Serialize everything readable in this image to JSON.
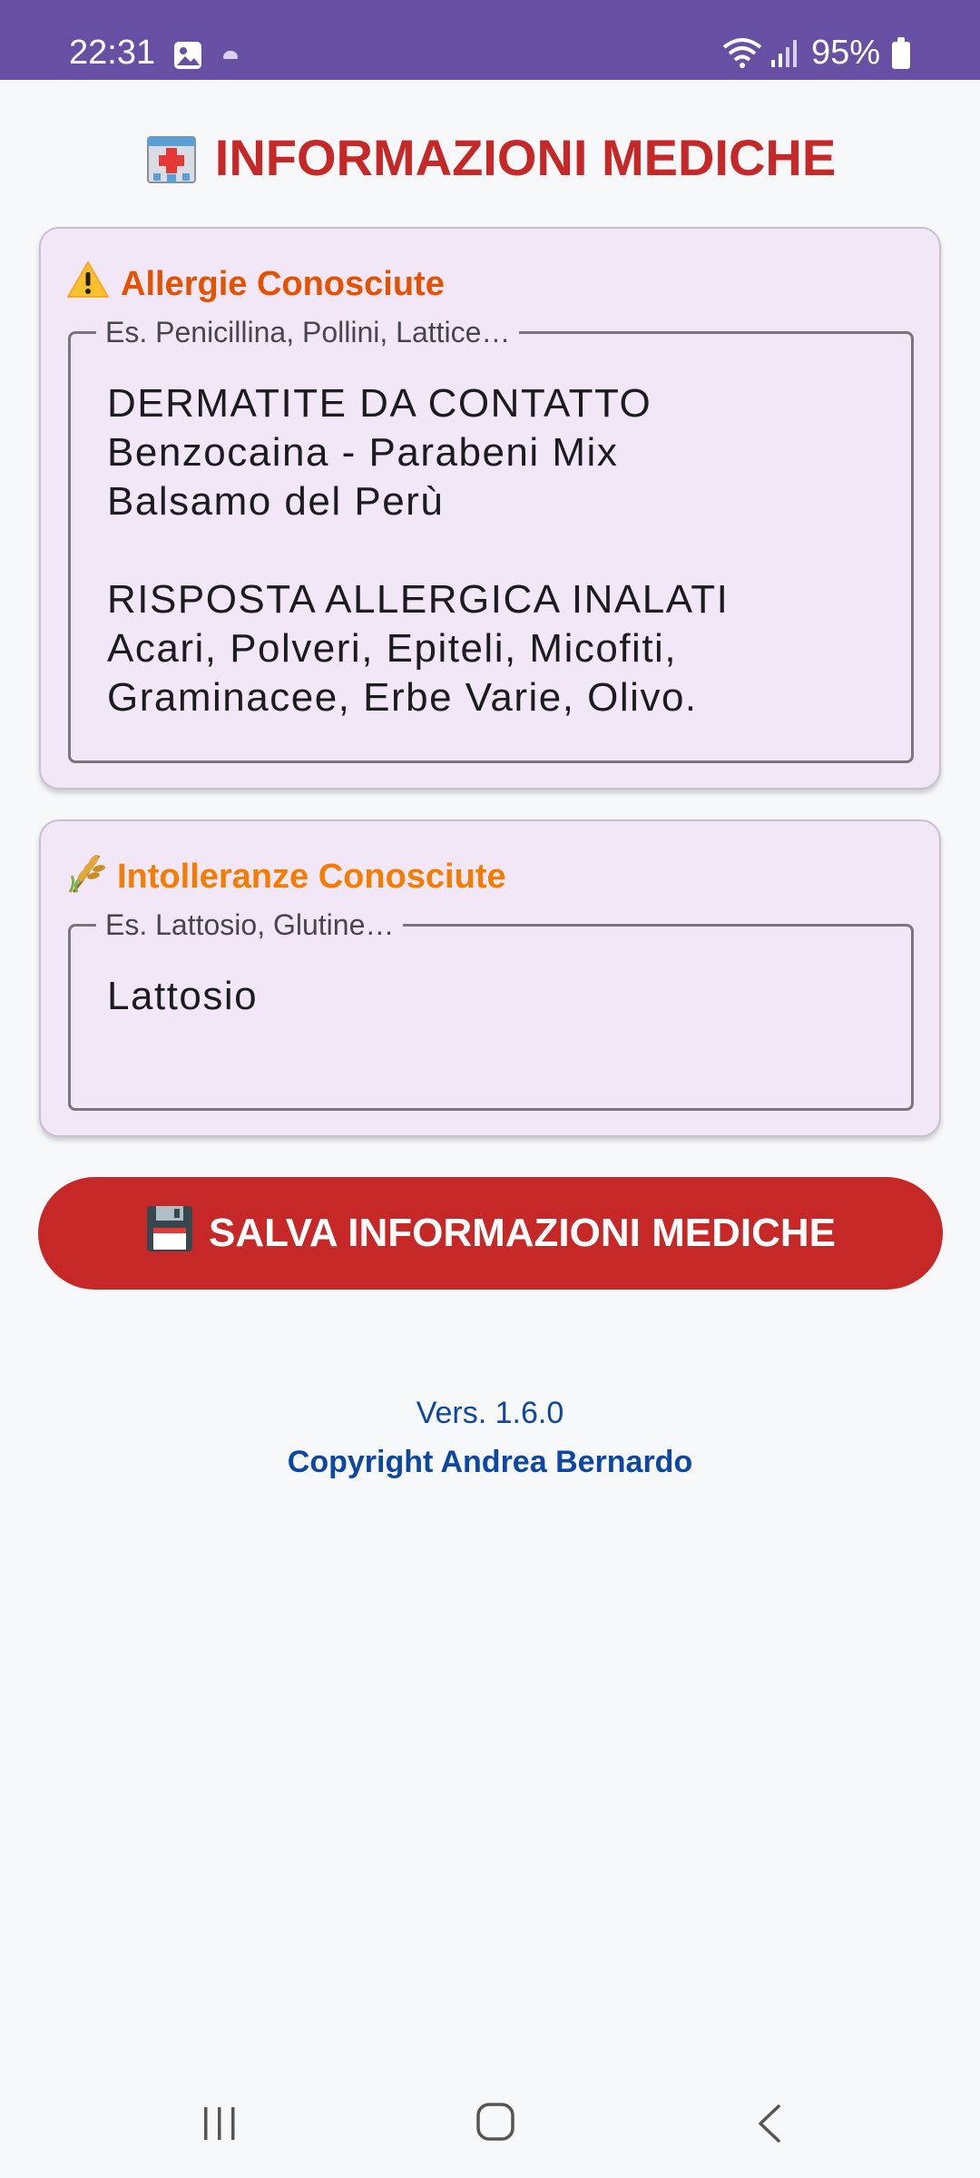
{
  "status_bar": {
    "time": "22:31",
    "battery": "95%",
    "icons": [
      "gallery-icon",
      "cloud-icon",
      "wifi-icon",
      "signal-icon",
      "battery-icon"
    ]
  },
  "header": {
    "title": "INFORMAZIONI MEDICHE",
    "icon": "hospital-icon",
    "color": "#c62828"
  },
  "allergies": {
    "heading": "Allergie Conosciute",
    "icon": "warning-icon",
    "label": "Es. Penicillina, Pollini, Lattice…",
    "value": "DERMATITE DA CONTATTO\nBenzocaina - Parabeni Mix\nBalsamo del Perù\n\nRISPOSTA ALLERGICA INALATI\nAcari, Polveri, Epiteli, Micofiti,\nGraminacee, Erbe Varie, Olivo."
  },
  "intolerances": {
    "heading": "Intolleranze Conosciute",
    "icon": "wheat-icon",
    "label": "Es. Lattosio, Glutine…",
    "value": "Lattosio"
  },
  "save_button": {
    "label": "SALVA INFORMAZIONI MEDICHE",
    "icon": "floppy-disk-icon"
  },
  "footer": {
    "version": "Vers. 1.6.0",
    "copyright": "Copyright Andrea Bernardo"
  },
  "colors": {
    "status_bar": "#6750a4",
    "accent_red": "#c62828",
    "allergy_heading": "#e65100",
    "intolerance_heading": "#f57c00",
    "footer_text": "#0d47a1"
  }
}
